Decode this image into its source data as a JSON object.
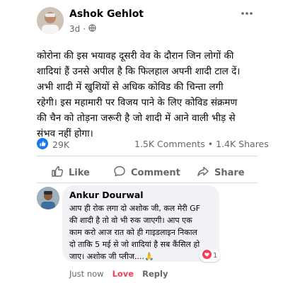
{
  "post": {
    "author": "Ashok Gehlot",
    "time": "3d",
    "separator": "·",
    "privacy_icon": "globe-icon",
    "menu_icon": "more-options-icon",
    "text_lines": [
      "कोरोना की इस भयावह दूसरी वेव के दौरान जिन लोगों की",
      "शादियां हैं उनसे अपील है कि फिलहाल अपनी शादी टाल दें।",
      "अभी शादी में खुशियों से अधिक कोविड की चिन्ता लगी",
      "रहेगी। इस महामारी पर विजय पाने के लिए कोविड संक्रमण",
      "की चैन को तोड़ना जरूरी है जो शादी में आने वाली भीड़ से",
      "संभव नहीं होगा।"
    ],
    "reactions_count": "29K",
    "comments_shares": "1.5K Comments • 1.4K Shares"
  },
  "actions": {
    "like": "Like",
    "comment": "Comment",
    "share": "Share"
  },
  "comment": {
    "author": "Ankur Dourwal",
    "text_lines": [
      "आप ही रोक लगा दो अशोक जी, कल मेरी GF",
      "की शादी है तो वो भी रुक जाएगी। आप एक",
      "काम करो आज रात को ही गाइडलाइन निकाल",
      "दो ताकि 5 मई से जो शादियां है सब कैंसिल हो",
      "जाए। अशोक जी प्लीज....🙏"
    ],
    "reaction_count": "1",
    "time": "Just now",
    "love_label": "Love",
    "reply_label": "Reply"
  },
  "colors": {
    "like_blue": "#1877f2",
    "love_red": "#f33e58",
    "muted": "#65676b"
  }
}
